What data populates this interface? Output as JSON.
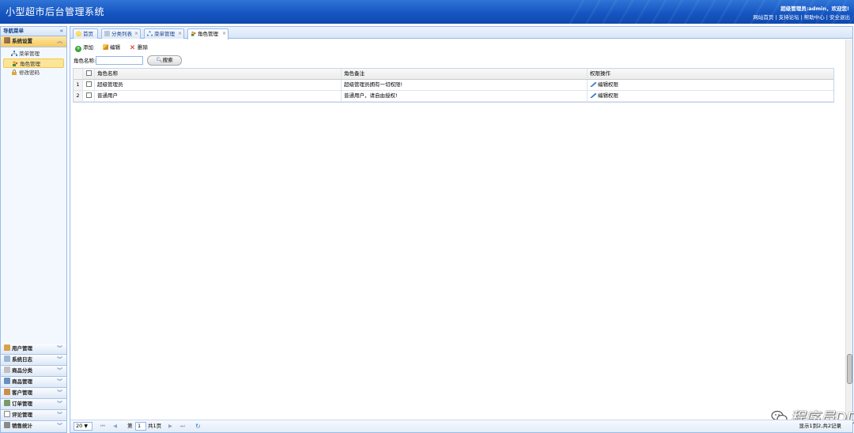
{
  "header": {
    "title": "小型超市后台管理系统",
    "welcome": "超级管理员:admin，欢迎您!",
    "links": [
      "网站首页",
      "支持论坛",
      "帮助中心",
      "安全退出"
    ]
  },
  "sidebar": {
    "title": "导航菜单",
    "active_group": "系统设置",
    "items": [
      {
        "label": "菜单管理",
        "icon": "tree-icon"
      },
      {
        "label": "角色管理",
        "icon": "role-icon",
        "selected": true
      },
      {
        "label": "修改密码",
        "icon": "lock-icon"
      }
    ],
    "groups": [
      "用户管理",
      "系统日志",
      "商品分类",
      "商品管理",
      "客户管理",
      "订单管理",
      "评论管理",
      "销售统计"
    ]
  },
  "tabs": [
    {
      "label": "首页",
      "closable": false
    },
    {
      "label": "分类列表",
      "closable": true
    },
    {
      "label": "菜单管理",
      "closable": true
    },
    {
      "label": "角色管理",
      "closable": true,
      "active": true
    }
  ],
  "toolbar": {
    "add": "添加",
    "edit": "编辑",
    "delete": "删除"
  },
  "search": {
    "label": "角色名称:",
    "value": "",
    "button": "搜索"
  },
  "grid": {
    "columns": [
      "角色名称",
      "角色备注",
      "权限操作"
    ],
    "rows": [
      {
        "num": "1",
        "name": "超级管理员",
        "desc": "超级管理员拥有一切权限!",
        "op": "编辑权限"
      },
      {
        "num": "2",
        "name": "普通用户",
        "desc": "普通用户，请自由授权!",
        "op": "编辑权限"
      }
    ]
  },
  "pager": {
    "page_size": "20",
    "page_label": "第",
    "page": "1",
    "total_pages": "共1页",
    "summary": "显示1到2,共2记录"
  },
  "watermark": "程序员DD",
  "colors": {
    "header": "#1656c2",
    "border": "#99bbe8",
    "active_item": "#fbe59a"
  }
}
